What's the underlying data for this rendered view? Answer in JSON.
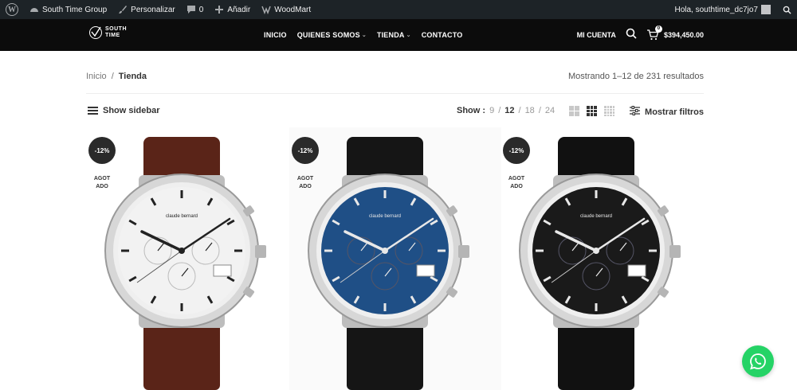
{
  "adminbar": {
    "site_name": "South Time Group",
    "customize": "Personalizar",
    "comments_count": "0",
    "add_new": "Añadir",
    "theme": "WoodMart",
    "greeting": "Hola, southtime_dc7jo7"
  },
  "header": {
    "logo_line1": "SOUTH",
    "logo_line2": "TIME",
    "nav": [
      {
        "label": "INICIO"
      },
      {
        "label": "QUIENES SOMOS"
      },
      {
        "label": "TIENDA"
      },
      {
        "label": "CONTACTO"
      }
    ],
    "account": "MI CUENTA",
    "cart_count": "0",
    "cart_total": "$394,450.00"
  },
  "breadcrumb": {
    "home": "Inicio",
    "separator": "/",
    "current": "Tienda"
  },
  "results_text": "Mostrando 1–12 de 231 resultados",
  "toolbar": {
    "sidebar_label": "Show sidebar",
    "show_label": "Show :",
    "per_page": [
      "9",
      "12",
      "18",
      "24"
    ],
    "per_page_selected": "12",
    "separator": "/",
    "filters_label": "Mostrar filtros"
  },
  "products": [
    {
      "badge": "-12%",
      "stock_line1": "AGOT",
      "stock_line2": "ADO",
      "dial_color": "#f2f2f2",
      "strap_color": "#5a2418",
      "brand": "claude bernard"
    },
    {
      "badge": "-12%",
      "stock_line1": "AGOT",
      "stock_line2": "ADO",
      "dial_color": "#1f4f86",
      "strap_color": "#151515",
      "brand": "claude bernard"
    },
    {
      "badge": "-12%",
      "stock_line1": "AGOT",
      "stock_line2": "ADO",
      "dial_color": "#1a1a1a",
      "strap_color": "#111111",
      "brand": "claude bernard"
    }
  ],
  "colors": {
    "adminbar": "#1d2327",
    "header": "#0c0c0c",
    "whatsapp": "#25d366"
  }
}
